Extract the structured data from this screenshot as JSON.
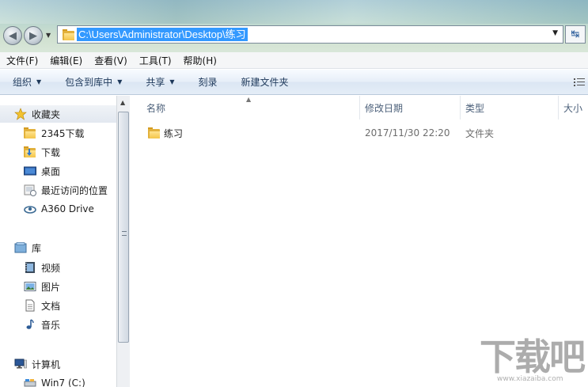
{
  "address_bar": {
    "path": "C:\\Users\\Administrator\\Desktop\\练习"
  },
  "menu": [
    "文件(F)",
    "编辑(E)",
    "查看(V)",
    "工具(T)",
    "帮助(H)"
  ],
  "toolbar": {
    "organize": "组织",
    "include_in_library": "包含到库中",
    "share": "共享",
    "burn": "刻录",
    "new_folder": "新建文件夹"
  },
  "nav": {
    "favorites": "收藏夹",
    "fav_items": [
      "2345下载",
      "下载",
      "桌面",
      "最近访问的位置",
      "A360 Drive"
    ],
    "libraries": "库",
    "lib_items": [
      "视频",
      "图片",
      "文档",
      "音乐"
    ],
    "computer": "计算机",
    "drive": "Win7 (C:)"
  },
  "columns": {
    "name": "名称",
    "modified": "修改日期",
    "type": "类型",
    "size": "大小"
  },
  "files": [
    {
      "name": "练习",
      "modified": "2017/11/30 22:20",
      "type": "文件夹"
    }
  ],
  "watermark": {
    "text": "下载吧",
    "sub": "www.xiazaiba.com"
  },
  "colors": {
    "selection": "#3399ff",
    "folder": "#f4c54a",
    "command_text": "#1e395b"
  }
}
